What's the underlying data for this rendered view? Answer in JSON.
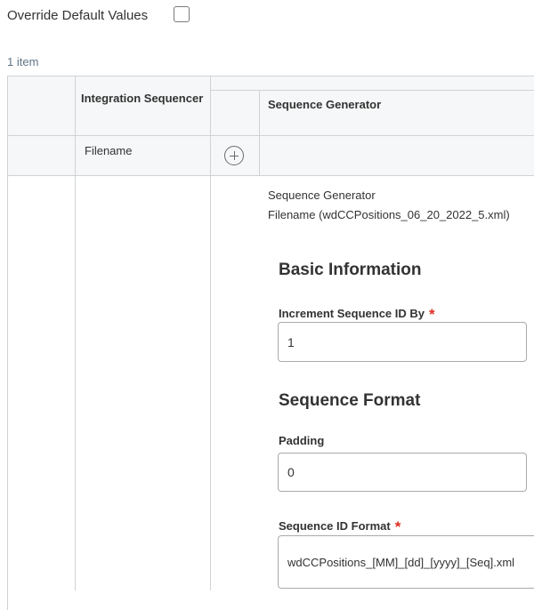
{
  "override": {
    "label": "Override Default Values",
    "checked": false
  },
  "grid": {
    "item_count": "1 item",
    "headers": {
      "integration_sequencer": "Integration Sequencer",
      "sequence_generator": "Sequence Generator"
    },
    "row": {
      "integration_sequencer_value": "Filename",
      "add_icon": "plus-circle-icon"
    }
  },
  "panel": {
    "title": "Sequence Generator",
    "subtitle": "Filename (wdCCPositions_06_20_2022_5.xml)",
    "basic_information": {
      "heading": "Basic Information",
      "increment_label": "Increment Sequence ID By",
      "increment_required": "*",
      "increment_value": "1"
    },
    "sequence_format": {
      "heading": "Sequence Format",
      "padding_label": "Padding",
      "padding_value": "0",
      "id_format_label": "Sequence ID Format",
      "id_format_required": "*",
      "id_format_value": "wdCCPositions_[MM]_[dd]_[yyyy]_[Seq].xml"
    }
  },
  "colors": {
    "required": "#de2e21",
    "border": "#cfd3d6",
    "header_bg": "#f6f7f8",
    "muted_text": "#5f7485"
  }
}
